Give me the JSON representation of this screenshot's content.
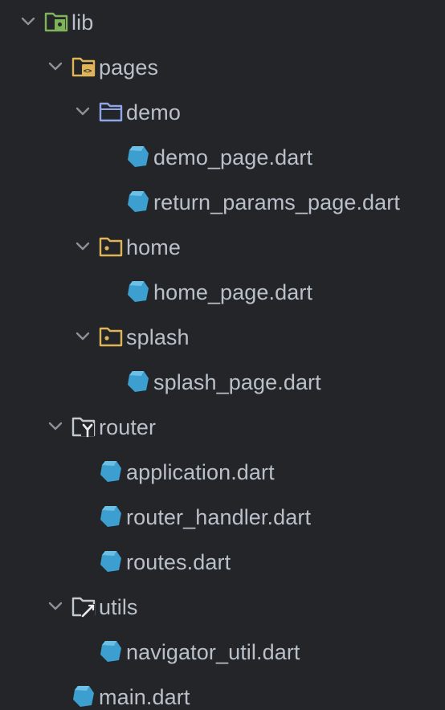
{
  "tree": {
    "lib": {
      "label": "lib",
      "icon": "folder-source-root-icon",
      "expanded": true
    },
    "pages": {
      "label": "pages",
      "icon": "folder-package-icon",
      "expanded": true
    },
    "demo": {
      "label": "demo",
      "icon": "folder-icon",
      "expanded": true
    },
    "demo_page": {
      "label": "demo_page.dart",
      "icon": "dart-file-icon"
    },
    "return_params_page": {
      "label": "return_params_page.dart",
      "icon": "dart-file-icon"
    },
    "home": {
      "label": "home",
      "icon": "folder-package-icon",
      "expanded": true
    },
    "home_page": {
      "label": "home_page.dart",
      "icon": "dart-file-icon"
    },
    "splash": {
      "label": "splash",
      "icon": "folder-package-icon",
      "expanded": true
    },
    "splash_page": {
      "label": "splash_page.dart",
      "icon": "dart-file-icon"
    },
    "router": {
      "label": "router",
      "icon": "folder-router-icon",
      "expanded": true
    },
    "application": {
      "label": "application.dart",
      "icon": "dart-file-icon"
    },
    "router_handler": {
      "label": "router_handler.dart",
      "icon": "dart-file-icon"
    },
    "routes": {
      "label": "routes.dart",
      "icon": "dart-file-icon"
    },
    "utils": {
      "label": "utils",
      "icon": "folder-utils-icon",
      "expanded": true
    },
    "navigator_util": {
      "label": "navigator_util.dart",
      "icon": "dart-file-icon"
    },
    "main": {
      "label": "main.dart",
      "icon": "dart-file-icon"
    }
  },
  "colors": {
    "background": "#232529",
    "text": "#bac0ca",
    "chevron": "#8c919a",
    "dart": "#3d9fd0",
    "folder_blue": "#8fa6e8",
    "folder_yellow": "#e0b55a",
    "folder_green": "#7fb35a",
    "folder_outline": "#c3c7cf"
  }
}
